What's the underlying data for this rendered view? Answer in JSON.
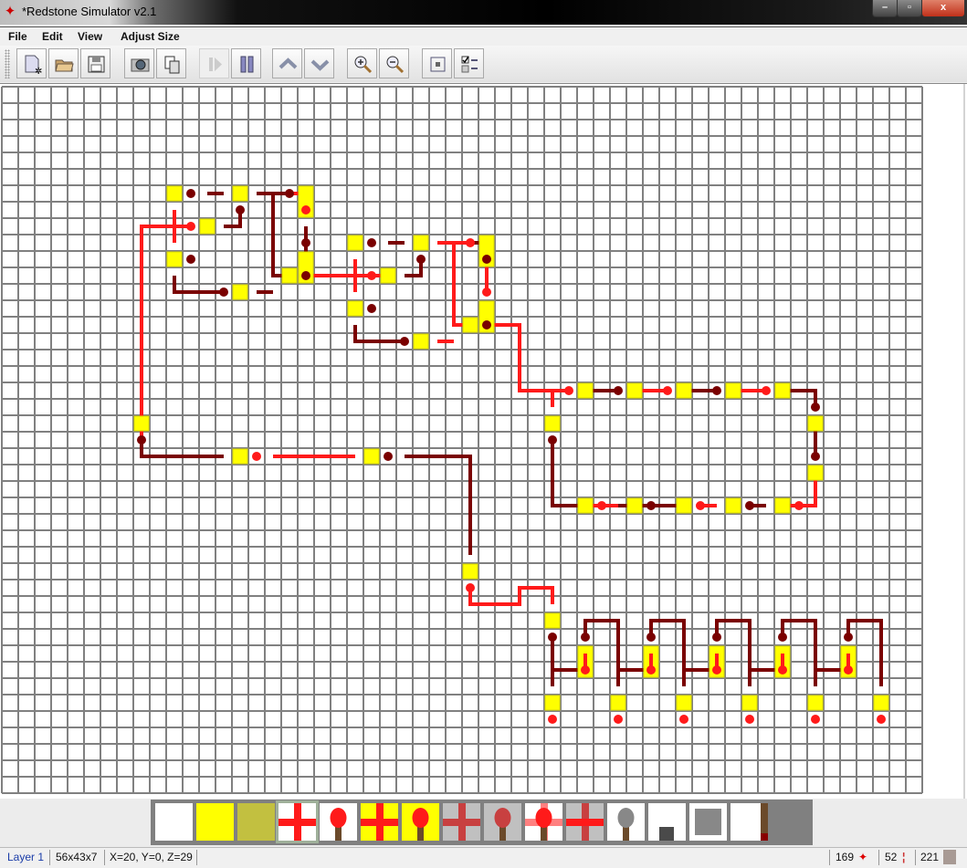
{
  "window": {
    "title": "*Redstone Simulator v2.1",
    "minimize": "–",
    "maximize": "▫",
    "close": "x"
  },
  "menu": [
    {
      "label": "File"
    },
    {
      "label": "Edit"
    },
    {
      "label": "View"
    },
    {
      "label": "Adjust Size"
    }
  ],
  "toolbar": [
    {
      "name": "new-file-button",
      "icon": "new-file-icon"
    },
    {
      "name": "open-button",
      "icon": "folder-icon"
    },
    {
      "name": "save-button",
      "icon": "floppy-icon"
    },
    {
      "name": "screenshot-button",
      "icon": "camera-icon"
    },
    {
      "name": "copy-button",
      "icon": "copy-icon"
    },
    {
      "name": "play-button",
      "icon": "play-icon",
      "disabled": true
    },
    {
      "name": "pause-button",
      "icon": "pause-icon"
    },
    {
      "name": "layer-up-button",
      "icon": "chevron-up-icon"
    },
    {
      "name": "layer-down-button",
      "icon": "chevron-down-icon"
    },
    {
      "name": "zoom-in-button",
      "icon": "zoom-in-icon"
    },
    {
      "name": "zoom-out-button",
      "icon": "zoom-out-icon"
    },
    {
      "name": "fit-button",
      "icon": "fit-icon"
    },
    {
      "name": "options-button",
      "icon": "checklist-icon"
    }
  ],
  "palette": [
    {
      "name": "air"
    },
    {
      "name": "block"
    },
    {
      "name": "block-dark"
    },
    {
      "name": "wire",
      "selected": true
    },
    {
      "name": "torch"
    },
    {
      "name": "block-wire"
    },
    {
      "name": "block-torch"
    },
    {
      "name": "wire-off"
    },
    {
      "name": "torch-off"
    },
    {
      "name": "torch-on-wire"
    },
    {
      "name": "wire-cross"
    },
    {
      "name": "lever"
    },
    {
      "name": "button"
    },
    {
      "name": "pressure-plate"
    },
    {
      "name": "door"
    }
  ],
  "status": {
    "layer": "Layer 1",
    "size": "56x43x7",
    "coords": "X=20, Y=0, Z=29",
    "wire_count": "169",
    "torch_count": "52",
    "block_count": "221"
  },
  "colors": {
    "wire_on": "#ff1a1a",
    "wire_off": "#7a0000",
    "block": "#ffff00",
    "grid_line": "#808080"
  },
  "grid": {
    "columns": 56,
    "rows": 43
  }
}
